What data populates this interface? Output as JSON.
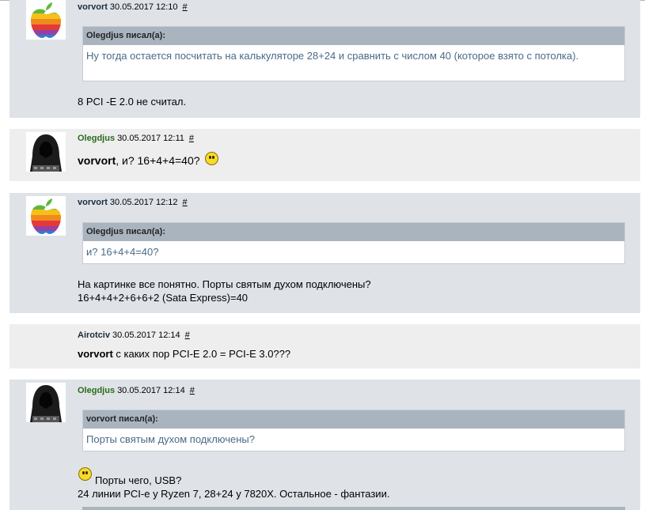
{
  "posts": [
    {
      "author": "vorvort",
      "time": "30.05.2017 12:10",
      "permalink": "#",
      "quote": {
        "header": "Olegdjus писал(а):",
        "text": "Ну тогда остается посчитать на калькуляторе 28+24 и сравнить с числом 40 (которое взято с потолка)."
      },
      "text": "8 PCI -E 2.0 не считал."
    },
    {
      "author": "Olegdjus",
      "time": "30.05.2017 12:11",
      "permalink": "#",
      "text_bold": "vorvort",
      "text": ", и? 16+4+4=40?"
    },
    {
      "author": "vorvort",
      "time": "30.05.2017 12:12",
      "permalink": "#",
      "quote": {
        "header": "Olegdjus писал(а):",
        "text": "и? 16+4+4=40?"
      },
      "line1": "На картинке все понятно. Порты святым духом подключены?",
      "line2": "16+4+4+2+6+6+2 (Sata Express)=40"
    },
    {
      "author": "Airotciv",
      "time": "30.05.2017 12:14",
      "permalink": "#",
      "text_bold": "vorvort",
      "text": " с каких пор PCI-E 2.0 = PCI-E 3.0???"
    },
    {
      "author": "Olegdjus",
      "time": "30.05.2017 12:14",
      "permalink": "#",
      "quote": {
        "header": "vorvort писал(а):",
        "text": "Порты святым духом подключены?"
      },
      "line1": "Порты чего, USB?",
      "line2": "24 линии PCI-e у Ryzen 7, 28+24 у 7820X. Остальное - фантазии."
    }
  ],
  "icons": {
    "apple_avatar": "rainbow-apple-icon",
    "hooded_avatar": "hooded-figure-icon",
    "smiley": "smiley-icon"
  },
  "colors": {
    "post_blue": "#dfe3e8",
    "post_gray": "#eeeeee",
    "quote_header": "#a9b4bf",
    "quote_text": "#4a6a86",
    "author_green": "#2a6b1a"
  }
}
